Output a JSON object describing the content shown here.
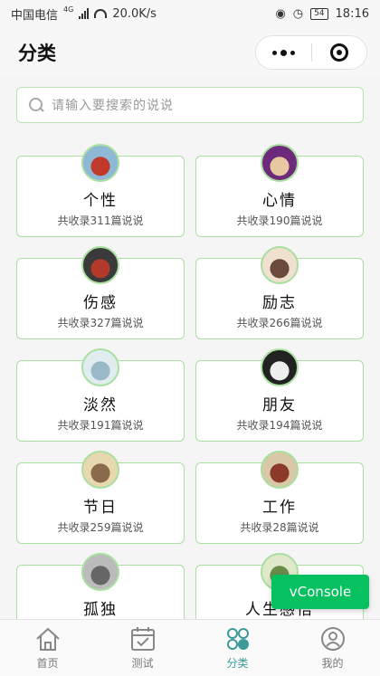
{
  "status": {
    "carrier": "中国电信",
    "network": "4G",
    "speed": "20.0K/s",
    "battery": "54",
    "time": "18:16"
  },
  "nav": {
    "title": "分类",
    "more_icon": "more-dots-icon",
    "close_icon": "target-icon"
  },
  "search": {
    "placeholder": "请输入要搜索的说说"
  },
  "categories": [
    {
      "name": "个性",
      "count": "共收录311篇说说",
      "avatar_colors": [
        "#8fb7d6",
        "#c0392b"
      ]
    },
    {
      "name": "心情",
      "count": "共收录190篇说说",
      "avatar_colors": [
        "#6d2a7a",
        "#e8c8a0"
      ]
    },
    {
      "name": "伤感",
      "count": "共收录327篇说说",
      "avatar_colors": [
        "#3a3a3a",
        "#b33a2a"
      ]
    },
    {
      "name": "励志",
      "count": "共收录266篇说说",
      "avatar_colors": [
        "#f0e0d0",
        "#6b4a3a"
      ]
    },
    {
      "name": "淡然",
      "count": "共收录191篇说说",
      "avatar_colors": [
        "#e0ecf0",
        "#9bb8c8"
      ]
    },
    {
      "name": "朋友",
      "count": "共收录194篇说说",
      "avatar_colors": [
        "#222222",
        "#eeeeee"
      ]
    },
    {
      "name": "节日",
      "count": "共收录259篇说说",
      "avatar_colors": [
        "#e8d8b0",
        "#8a6a4a"
      ]
    },
    {
      "name": "工作",
      "count": "共收录28篇说说",
      "avatar_colors": [
        "#d8c8a8",
        "#8b3a2a"
      ]
    },
    {
      "name": "孤独",
      "count": "",
      "avatar_colors": [
        "#bbbbbb",
        "#666666"
      ]
    },
    {
      "name": "人生感悟",
      "count": "",
      "avatar_colors": [
        "#dfe8c8",
        "#6a8a4a"
      ]
    }
  ],
  "vconsole": {
    "label": "vConsole",
    "color": "#07c160"
  },
  "tabs": [
    {
      "label": "首页",
      "icon": "home-icon"
    },
    {
      "label": "测试",
      "icon": "calendar-check-icon"
    },
    {
      "label": "分类",
      "icon": "category-icon",
      "active": true
    },
    {
      "label": "我的",
      "icon": "user-icon"
    }
  ],
  "colors": {
    "accent_green": "#a9dfa0",
    "active_tab": "#3c9a9a"
  }
}
